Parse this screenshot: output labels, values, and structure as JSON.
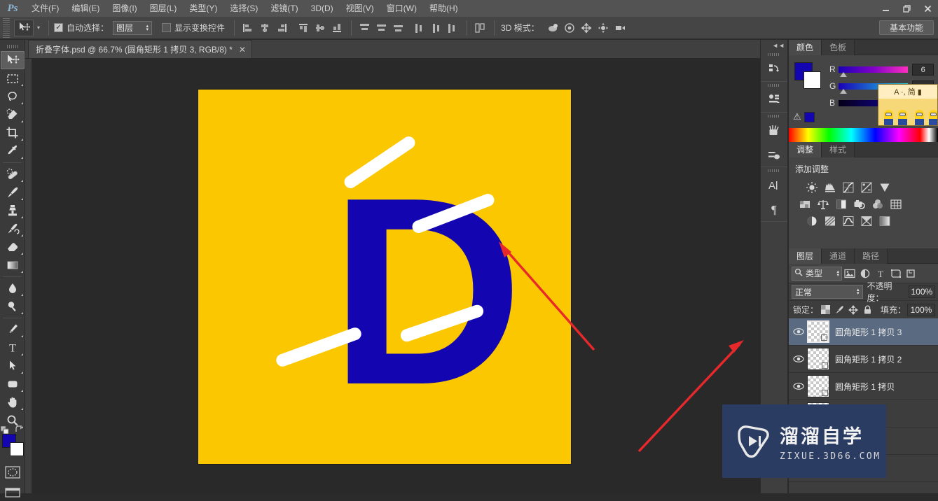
{
  "app": {
    "logo": "Ps",
    "workspace_button": "基本功能"
  },
  "window_controls": {
    "minimize": "—",
    "restore": "❐",
    "close": "✕"
  },
  "menubar": {
    "items": [
      {
        "label": "文件(F)"
      },
      {
        "label": "编辑(E)"
      },
      {
        "label": "图像(I)"
      },
      {
        "label": "图层(L)"
      },
      {
        "label": "类型(Y)"
      },
      {
        "label": "选择(S)"
      },
      {
        "label": "滤镜(T)"
      },
      {
        "label": "3D(D)"
      },
      {
        "label": "视图(V)"
      },
      {
        "label": "窗口(W)"
      },
      {
        "label": "帮助(H)"
      }
    ]
  },
  "options_bar": {
    "tool_icon": "move-tool",
    "auto_select_checked": true,
    "auto_select_label": "自动选择：",
    "auto_select_value": "图层",
    "show_transform_checked": false,
    "show_transform_label": "显示变换控件",
    "align_icons": [
      "align-left-edges",
      "align-horizontal-centers",
      "align-right-edges",
      "align-top-edges",
      "align-vertical-centers",
      "align-bottom-edges",
      "distribute-top-edges",
      "distribute-vertical-centers",
      "distribute-bottom-edges",
      "distribute-left-edges",
      "distribute-horizontal-centers",
      "distribute-right-edges",
      "auto-align-layers"
    ],
    "mode3d_label": "3D 模式：",
    "mode3d_icons": [
      "rotate-3d-object",
      "roll-3d-object",
      "pan-3d-object",
      "slide-3d-object",
      "scale-3d-object"
    ]
  },
  "toolbar": {
    "tools": [
      {
        "name": "move-tool",
        "active": true
      },
      {
        "name": "rectangular-marquee-tool",
        "active": false
      },
      {
        "name": "lasso-tool",
        "active": false
      },
      {
        "name": "quick-selection-tool",
        "active": false
      },
      {
        "name": "crop-tool",
        "active": false
      },
      {
        "name": "eyedropper-tool",
        "active": false
      },
      {
        "name": "spot-healing-brush-tool",
        "active": false
      },
      {
        "name": "brush-tool",
        "active": false
      },
      {
        "name": "clone-stamp-tool",
        "active": false
      },
      {
        "name": "history-brush-tool",
        "active": false
      },
      {
        "name": "eraser-tool",
        "active": false
      },
      {
        "name": "gradient-tool",
        "active": false
      },
      {
        "name": "blur-tool",
        "active": false
      },
      {
        "name": "dodge-tool",
        "active": false
      },
      {
        "name": "pen-tool",
        "active": false
      },
      {
        "name": "horizontal-type-tool",
        "active": false
      },
      {
        "name": "path-selection-tool",
        "active": false
      },
      {
        "name": "rounded-rectangle-tool",
        "active": false
      },
      {
        "name": "hand-tool",
        "active": false
      },
      {
        "name": "zoom-tool",
        "active": false
      }
    ],
    "foreground_color": "#1305AF",
    "background_color": "#FFFFFF"
  },
  "document": {
    "tab_title": "折叠字体.psd @ 66.7% (圆角矩形 1 拷贝 3, RGB/8) *",
    "close_glyph": "✕",
    "canvas": {
      "background_color": "#FBC700",
      "letter": "D",
      "letter_color": "#1305AF",
      "stripe_color": "#FFFFFF",
      "stripe_count": 4
    }
  },
  "icon_dock": {
    "collapse_glyph": "◄◄",
    "icons": [
      {
        "name": "history-panel-icon"
      },
      {
        "name": "actions-panel-icon"
      },
      {
        "name": "brush-presets-panel-icon"
      },
      {
        "name": "brush-panel-icon"
      },
      {
        "name": "character-panel-icon"
      },
      {
        "name": "paragraph-panel-icon"
      }
    ]
  },
  "color_panel": {
    "tabs": [
      {
        "label": "颜色",
        "active": true
      },
      {
        "label": "色板",
        "active": false
      }
    ],
    "channels": [
      {
        "label": "R",
        "value": "6"
      },
      {
        "label": "G",
        "value": ""
      },
      {
        "label": "B",
        "value": ""
      }
    ],
    "foreground_color": "#1305AF",
    "background_color": "#FFFFFF",
    "out_of_gamut_warning": "⚠"
  },
  "popup_thumbnail": {
    "caption": "A ·, 简 ▮"
  },
  "adjustments_panel": {
    "tabs": [
      {
        "label": "调整",
        "active": true
      },
      {
        "label": "样式",
        "active": false
      }
    ],
    "title": "添加调整",
    "rows": [
      [
        "brightness-contrast-icon",
        "levels-icon",
        "curves-icon",
        "exposure-icon",
        "vibrance-icon"
      ],
      [
        "hue-saturation-icon",
        "color-balance-icon",
        "black-white-icon",
        "photo-filter-icon",
        "channel-mixer-icon",
        "color-lookup-icon"
      ],
      [
        "invert-icon",
        "posterize-icon",
        "threshold-icon",
        "selective-color-icon",
        "gradient-map-icon"
      ]
    ]
  },
  "layers_panel": {
    "tabs": [
      {
        "label": "图层",
        "active": true
      },
      {
        "label": "通道",
        "active": false
      },
      {
        "label": "路径",
        "active": false
      }
    ],
    "filter": {
      "search_icon": "search-icon",
      "type_label": "类型"
    },
    "filter_icons": [
      "filter-pixel-icon",
      "filter-adjustment-icon",
      "filter-type-icon",
      "filter-shape-icon",
      "filter-smart-object-icon"
    ],
    "blend_mode": "正常",
    "opacity_label": "不透明度：",
    "opacity_value": "100%",
    "lock_label": "锁定：",
    "lock_icons": [
      "lock-transparent-pixels-icon",
      "lock-image-pixels-icon",
      "lock-position-icon",
      "lock-all-icon"
    ],
    "fill_label": "填充：",
    "fill_value": "100%",
    "layers": [
      {
        "name": "圆角矩形 1 拷贝 3",
        "visible": true,
        "selected": true
      },
      {
        "name": "圆角矩形 1 拷贝 2",
        "visible": true,
        "selected": false
      },
      {
        "name": "圆角矩形 1 拷贝",
        "visible": true,
        "selected": false
      },
      {
        "name": "",
        "visible": true,
        "selected": false
      }
    ]
  },
  "watermark": {
    "title": "溜溜自学",
    "subtitle": "ZIXUE.3D66.COM",
    "background_color": "#2B3C63"
  },
  "annotations": {
    "arrow_color": "#E8282A",
    "arrows": [
      {
        "name": "arrow-to-canvas-letter"
      },
      {
        "name": "arrow-to-layers-panel"
      }
    ]
  }
}
